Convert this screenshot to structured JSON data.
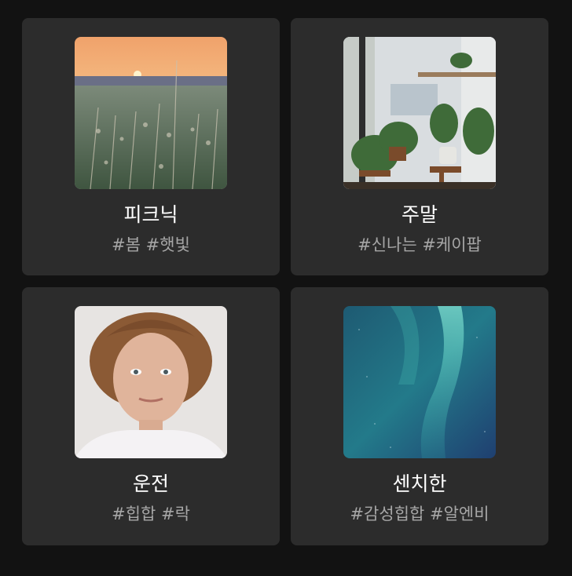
{
  "playlists": [
    {
      "title": "피크닉",
      "tags": "#봄 #햇빛",
      "image_icon": "sunset-meadow-image",
      "colors": {
        "sky_top": "#f2a06a",
        "sky_bottom": "#f8d7a0",
        "grass": "#5e6f59"
      }
    },
    {
      "title": "주말",
      "tags": "#신나는 #케이팝",
      "image_icon": "houseplants-cafe-image",
      "colors": {
        "wall": "#dfe3e6",
        "plant": "#3e6b3a",
        "wood": "#7b4c2e"
      }
    },
    {
      "title": "운전",
      "tags": "#힙합 #락",
      "image_icon": "portrait-image",
      "colors": {
        "bg": "#e9e6e3",
        "hair": "#8a5a36",
        "skin": "#e2b8a0"
      }
    },
    {
      "title": "센치한",
      "tags": "#감성힙합 #알엔비",
      "image_icon": "aurora-image",
      "colors": {
        "sky": "#1f4f7a",
        "aurora": "#4ec9c0"
      }
    }
  ]
}
